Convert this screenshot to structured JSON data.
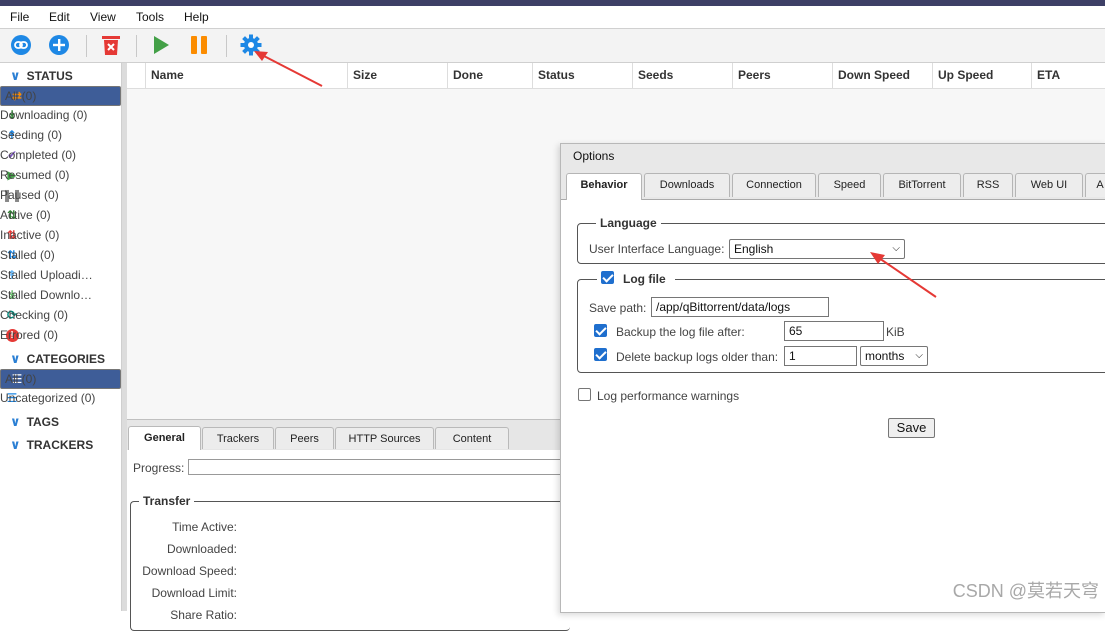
{
  "menu": [
    "File",
    "Edit",
    "View",
    "Tools",
    "Help"
  ],
  "toolbar": {
    "icons": [
      "link-icon",
      "add-icon",
      "delete-icon",
      "play-icon",
      "pause-icon",
      "gear-icon"
    ],
    "colors": {
      "blue": "#1e88e5",
      "red": "#e53935",
      "green": "#43a047",
      "orange": "#fb8c00"
    }
  },
  "sidebar": {
    "status_header": "STATUS",
    "status_items": [
      {
        "label": "All (0)",
        "icon": "shuffle-icon"
      },
      {
        "label": "Downloading (0)",
        "icon": "download-icon"
      },
      {
        "label": "Seeding (0)",
        "icon": "upload-icon"
      },
      {
        "label": "Completed (0)",
        "icon": "check-icon"
      },
      {
        "label": "Resumed (0)",
        "icon": "play-icon"
      },
      {
        "label": "Paused (0)",
        "icon": "pause-icon"
      },
      {
        "label": "Active (0)",
        "icon": "updown-icon"
      },
      {
        "label": "Inactive (0)",
        "icon": "updown-red-icon"
      },
      {
        "label": "Stalled (0)",
        "icon": "updown-blue-icon"
      },
      {
        "label": "Stalled Uploadi…",
        "icon": "upload-icon"
      },
      {
        "label": "Stalled Downlo…",
        "icon": "download-icon"
      },
      {
        "label": "Checking (0)",
        "icon": "refresh-icon"
      },
      {
        "label": "Errored (0)",
        "icon": "error-icon"
      }
    ],
    "categories_header": "CATEGORIES",
    "category_items": [
      {
        "label": "All (0)",
        "icon": "list-icon"
      },
      {
        "label": "Uncategorized (0)",
        "icon": "list-icon"
      }
    ],
    "tags_header": "TAGS",
    "trackers_header": "TRACKERS"
  },
  "columns": [
    "Name",
    "Size",
    "Done",
    "Status",
    "Seeds",
    "Peers",
    "Down Speed",
    "Up Speed",
    "ETA"
  ],
  "bottom_tabs": [
    "General",
    "Trackers",
    "Peers",
    "HTTP Sources",
    "Content"
  ],
  "props": {
    "progress_label": "Progress:",
    "transfer_legend": "Transfer",
    "fields": [
      "Time Active:",
      "Downloaded:",
      "Download Speed:",
      "Download Limit:",
      "Share Ratio:"
    ]
  },
  "options": {
    "title": "Options",
    "tabs": [
      "Behavior",
      "Downloads",
      "Connection",
      "Speed",
      "BitTorrent",
      "RSS",
      "Web UI",
      "A"
    ],
    "language_legend": "Language",
    "ui_language_label": "User Interface Language:",
    "ui_language_value": "English",
    "logfile_legend": "Log file",
    "save_path_label": "Save path:",
    "save_path_value": "/app/qBittorrent/data/logs",
    "backup_label": "Backup the log file after:",
    "backup_value": "65",
    "backup_unit": "KiB",
    "delete_label": "Delete backup logs older than:",
    "delete_value": "1",
    "delete_unit": "months",
    "perf_label": "Log performance warnings",
    "save_button": "Save"
  },
  "watermark": "CSDN @莫若天穹"
}
